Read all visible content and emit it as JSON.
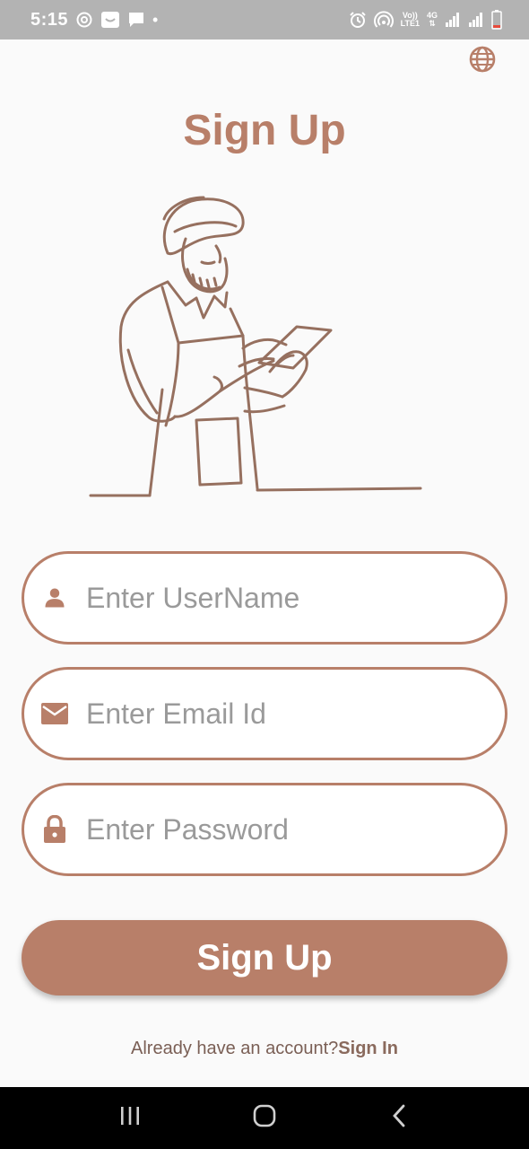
{
  "status_bar": {
    "time": "5:15",
    "dot": "•",
    "volte_top": "Vo))",
    "volte_bottom": "LTE1",
    "network": "4G",
    "icons": [
      "sync-icon",
      "cat-face-icon",
      "message-icon",
      "alarm-icon",
      "hotspot-icon",
      "signal-icon",
      "battery-low-icon"
    ]
  },
  "header": {
    "language_icon": "globe-icon"
  },
  "title": "Sign Up",
  "illustration": "man-with-tablet-illustration",
  "form": {
    "username_placeholder": "Enter UserName",
    "email_placeholder": "Enter Email Id",
    "password_placeholder": "Enter Password",
    "username_icon": "person-icon",
    "email_icon": "mail-icon",
    "password_icon": "lock-icon"
  },
  "submit_label": "Sign Up",
  "footer": {
    "prompt": "Already have an account?",
    "link": "Sign In"
  },
  "colors": {
    "accent": "#b87f69",
    "status_bar": "#b3b3b3",
    "nav_bar": "#000000",
    "background": "#fafafa"
  }
}
